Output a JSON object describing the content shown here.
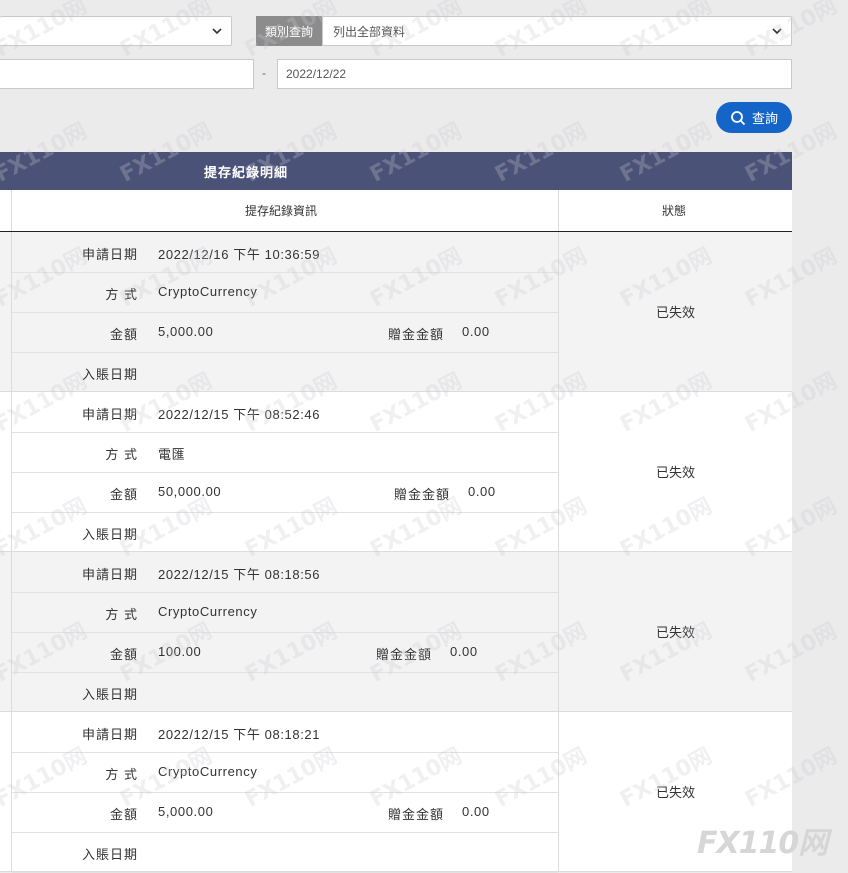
{
  "filters": {
    "category_tag": "類別查詢",
    "category_value": "列出全部資料",
    "date_separator": "-",
    "date_end": "2022/12/22",
    "search_button": "查詢"
  },
  "table": {
    "title": "提存紀錄明細",
    "col_info": "提存紀錄資訊",
    "col_status": "狀態"
  },
  "labels": {
    "apply_date": "申請日期",
    "method": "方 式",
    "amount": "金額",
    "bonus_amount": "贈金金額",
    "deposit_date": "入賬日期"
  },
  "records": [
    {
      "apply_date": "2022/12/16 下午 10:36:59",
      "method": "CryptoCurrency",
      "amount": "5,000.00",
      "bonus": "0.00",
      "deposit_date": "",
      "status": "已失效"
    },
    {
      "apply_date": "2022/12/15 下午 08:52:46",
      "method": "電匯",
      "amount": "50,000.00",
      "bonus": "0.00",
      "deposit_date": "",
      "status": "已失效"
    },
    {
      "apply_date": "2022/12/15 下午 08:18:56",
      "method": "CryptoCurrency",
      "amount": "100.00",
      "bonus": "0.00",
      "deposit_date": "",
      "status": "已失效"
    },
    {
      "apply_date": "2022/12/15 下午 08:18:21",
      "method": "CryptoCurrency",
      "amount": "5,000.00",
      "bonus": "0.00",
      "deposit_date": "",
      "status": "已失效"
    }
  ],
  "watermark": "FX110网",
  "icons": {
    "search": "search-icon",
    "chevron": "chevron-down-icon"
  },
  "colors": {
    "header_bg": "#4b5278",
    "button_bg": "#1565c9",
    "tag_bg": "#8c8c8c"
  }
}
